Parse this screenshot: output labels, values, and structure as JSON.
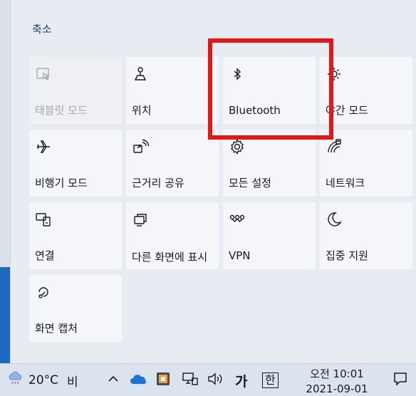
{
  "action_center": {
    "collapse_label": "축소",
    "tiles": [
      {
        "label": "태블릿 모드",
        "icon": "tablet-mode-icon",
        "enabled": false
      },
      {
        "label": "위치",
        "icon": "location-icon",
        "enabled": true
      },
      {
        "label": "Bluetooth",
        "icon": "bluetooth-icon",
        "enabled": true
      },
      {
        "label": "야간 모드",
        "icon": "night-light-icon",
        "enabled": true
      },
      {
        "label": "비행기 모드",
        "icon": "airplane-icon",
        "enabled": true
      },
      {
        "label": "근거리 공유",
        "icon": "nearby-share-icon",
        "enabled": true
      },
      {
        "label": "모든 설정",
        "icon": "settings-gear-icon",
        "enabled": true
      },
      {
        "label": "네트워크",
        "icon": "network-icon",
        "enabled": true
      },
      {
        "label": "연결",
        "icon": "connect-icon",
        "enabled": true
      },
      {
        "label": "다른 화면에 표시",
        "icon": "project-icon",
        "enabled": true
      },
      {
        "label": "VPN",
        "icon": "vpn-icon",
        "enabled": true
      },
      {
        "label": "집중 지원",
        "icon": "focus-assist-icon",
        "enabled": true
      },
      {
        "label": "화면 캡처",
        "icon": "screen-snip-icon",
        "enabled": true
      }
    ],
    "highlight_color": "#e51616"
  },
  "taskbar": {
    "weather_temp": "20°C",
    "weather_condition": "비",
    "ime_lang": "가",
    "ime_mode": "한",
    "clock_time": "오전 10:01",
    "clock_date": "2021-09-01"
  },
  "colors": {
    "tile_bg": "#f4f6f9",
    "panel_bg": "#e8ebf1",
    "accent_blue": "#1d68c3"
  }
}
